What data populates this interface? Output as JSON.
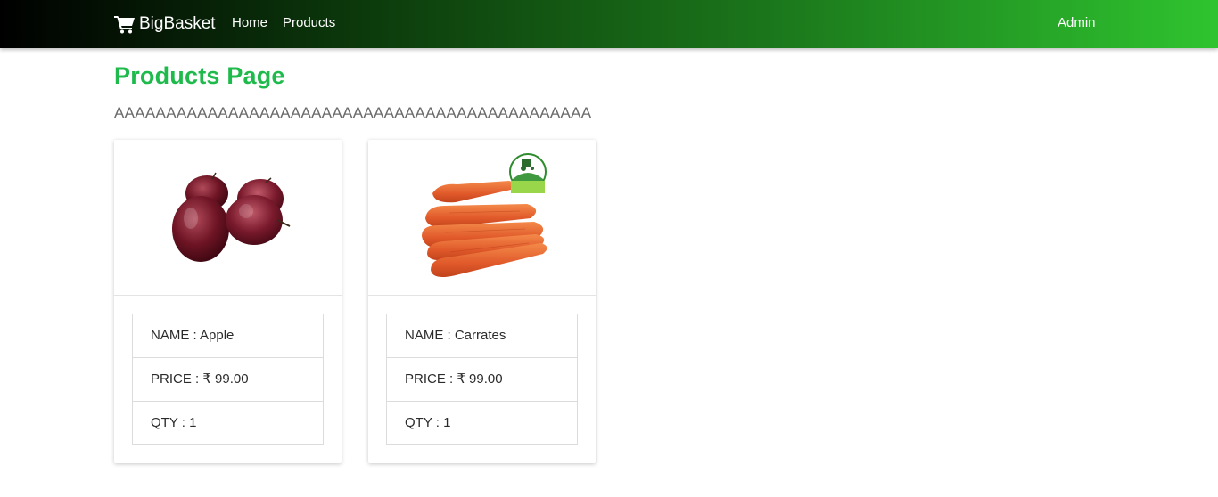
{
  "navbar": {
    "brand": "BigBasket",
    "brand_icon": "shopping-cart-icon",
    "links": [
      "Home",
      "Products"
    ],
    "user": "Admin",
    "gradient_colors": [
      "#000000",
      "#2fc42f"
    ]
  },
  "page": {
    "title": "Products Page",
    "description": "AAAAAAAAAAAAAAAAAAAAAAAAAAAAAAAAAAAAAAAAAAAAAA",
    "title_color": "#1fba4c"
  },
  "products": [
    {
      "image": "apple-image",
      "name_text": "NAME : Apple",
      "price_text": "PRICE : ₹ 99.00",
      "qty_text": "QTY : 1"
    },
    {
      "image": "carrot-image",
      "name_text": "NAME : Carrates",
      "price_text": "PRICE : ₹ 99.00",
      "qty_text": "QTY : 1"
    }
  ]
}
